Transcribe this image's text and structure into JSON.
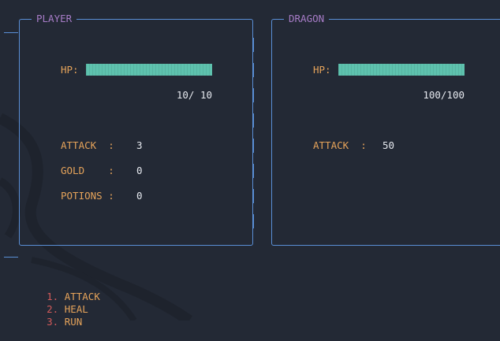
{
  "player": {
    "title": "PLAYER",
    "hp_label": "HP:",
    "hp_text": "10/ 10",
    "hp_fraction": 1.0,
    "attack_label": "ATTACK  :",
    "attack_value": "3",
    "gold_label": "GOLD    :",
    "gold_value": "0",
    "potions_label": "POTIONS :",
    "potions_value": "0"
  },
  "dragon": {
    "title": "DRAGON",
    "hp_label": "HP:",
    "hp_text": "100/100",
    "hp_fraction": 1.0,
    "attack_label": "ATTACK  :",
    "attack_value": "50"
  },
  "menu": [
    {
      "num": "1.",
      "label": "ATTACK"
    },
    {
      "num": "2.",
      "label": "HEAL"
    },
    {
      "num": "3.",
      "label": "RUN"
    }
  ],
  "colors": {
    "background": "#232935",
    "border": "#5a8fd6",
    "title": "#a77cc7",
    "label": "#e5a35a",
    "hp_bar": "#5ec2ae",
    "menu_number": "#d25a5a"
  }
}
